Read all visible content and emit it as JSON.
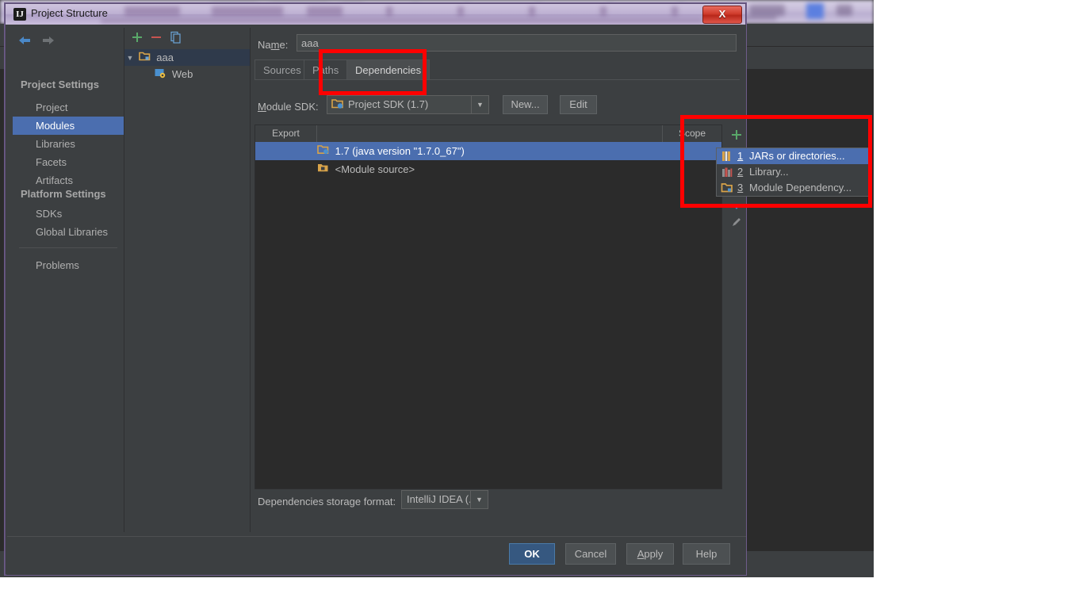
{
  "window": {
    "title": "Project Structure",
    "app_icon": "IJ",
    "close_label": "X"
  },
  "sidebar": {
    "nav": {
      "back": "back-arrow",
      "forward": "forward-arrow"
    },
    "groups": [
      {
        "label": "Project Settings"
      },
      {
        "label": "Platform Settings"
      }
    ],
    "items": [
      {
        "label": "Project",
        "selected": false
      },
      {
        "label": "Modules",
        "selected": true
      },
      {
        "label": "Libraries",
        "selected": false
      },
      {
        "label": "Facets",
        "selected": false
      },
      {
        "label": "Artifacts",
        "selected": false
      },
      {
        "label": "SDKs",
        "selected": false
      },
      {
        "label": "Global Libraries",
        "selected": false
      },
      {
        "label": "Problems",
        "selected": false
      }
    ]
  },
  "tree": {
    "toolbar": [
      "add-icon",
      "remove-icon",
      "copy-icon"
    ],
    "nodes": [
      {
        "label": "aaa",
        "icon": "module-folder-icon",
        "expanded": true,
        "selected": true
      },
      {
        "label": "Web",
        "icon": "web-facet-icon",
        "expanded": false,
        "selected": false
      }
    ]
  },
  "module": {
    "name_label": "Na",
    "name_label_underlined": "m",
    "name_label_rest": "e:",
    "name_value": "aaa",
    "tabs": [
      {
        "label": "Sources",
        "active": false
      },
      {
        "label": "Paths",
        "active": false
      },
      {
        "label": "Dependencies",
        "active": true
      }
    ],
    "sdk_label": "Module SDK:",
    "sdk_label_underlined": "M",
    "sdk_value": "Project SDK (1.7)",
    "new_button": "New...",
    "edit_button": "Edit"
  },
  "dependencies": {
    "columns": [
      {
        "label": "Export"
      },
      {
        "label": ""
      },
      {
        "label": "Scope"
      }
    ],
    "rows": [
      {
        "label": "1.7 (java version \"1.7.0_67\")",
        "icon": "jdk-icon",
        "selected": true,
        "export": "",
        "scope": ""
      },
      {
        "label": "<Module source>",
        "icon": "module-source-icon",
        "selected": false,
        "export": "",
        "scope": ""
      }
    ],
    "side_actions": [
      "add-icon",
      "arrow-down-icon",
      "edit-pencil-icon"
    ],
    "storage_label": "Dependencies storage format:",
    "storage_value": "IntelliJ IDEA (.iml)"
  },
  "popup": {
    "items": [
      {
        "num": "1",
        "label": "JARs or directories...",
        "icon": "jar-icon",
        "highlight": true
      },
      {
        "num": "2",
        "label": "Library...",
        "icon": "library-icon",
        "highlight": false
      },
      {
        "num": "3",
        "label": "Module Dependency...",
        "icon": "module-icon",
        "highlight": false
      }
    ]
  },
  "buttons": {
    "ok": "OK",
    "cancel": "Cancel",
    "apply_pre": "",
    "apply_underlined": "A",
    "apply_rest": "pply",
    "apply": "Apply",
    "help": "Help"
  },
  "annotations": {
    "highlight_color": "#ff0000",
    "boxes": [
      {
        "name": "dependencies-tab-highlight"
      },
      {
        "name": "add-dependency-menu-highlight"
      }
    ]
  },
  "colors": {
    "selection_blue": "#4b6eaf",
    "default_button_blue": "#365880",
    "panel_bg": "#3c3f41",
    "table_bg": "#2b2b2b"
  }
}
